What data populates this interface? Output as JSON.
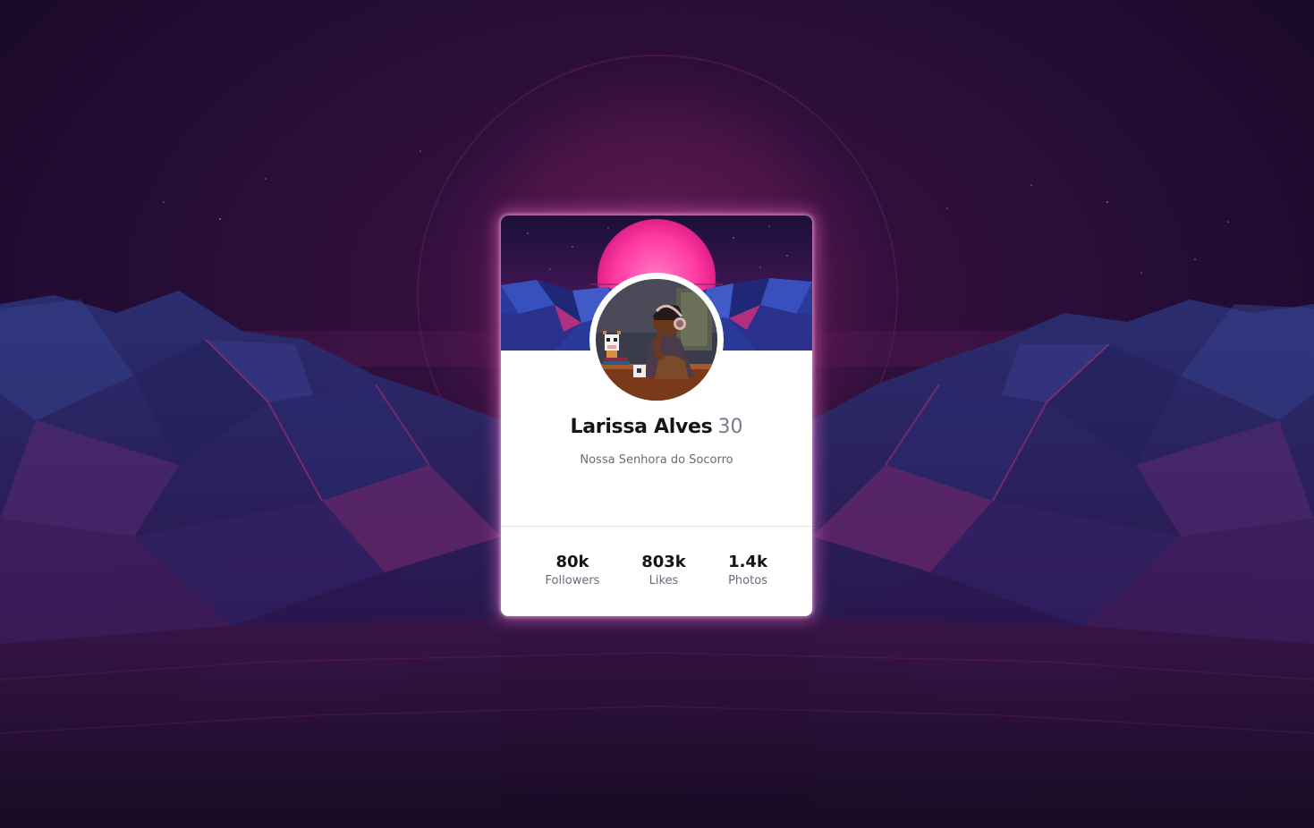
{
  "profile": {
    "name": "Larissa Alves",
    "age": "30",
    "location": "Nossa Senhora do Socorro"
  },
  "stats": [
    {
      "value": "80k",
      "label": "Followers"
    },
    {
      "value": "803k",
      "label": "Likes"
    },
    {
      "value": "1.4k",
      "label": "Photos"
    }
  ],
  "colors": {
    "background_dark": "#1e0b2e",
    "glow_pink": "#ff4fa8",
    "mountain_blue": "#2a2f7a",
    "card_bg": "#ffffff",
    "name_text": "#151515",
    "muted_text": "#6a6a78"
  }
}
